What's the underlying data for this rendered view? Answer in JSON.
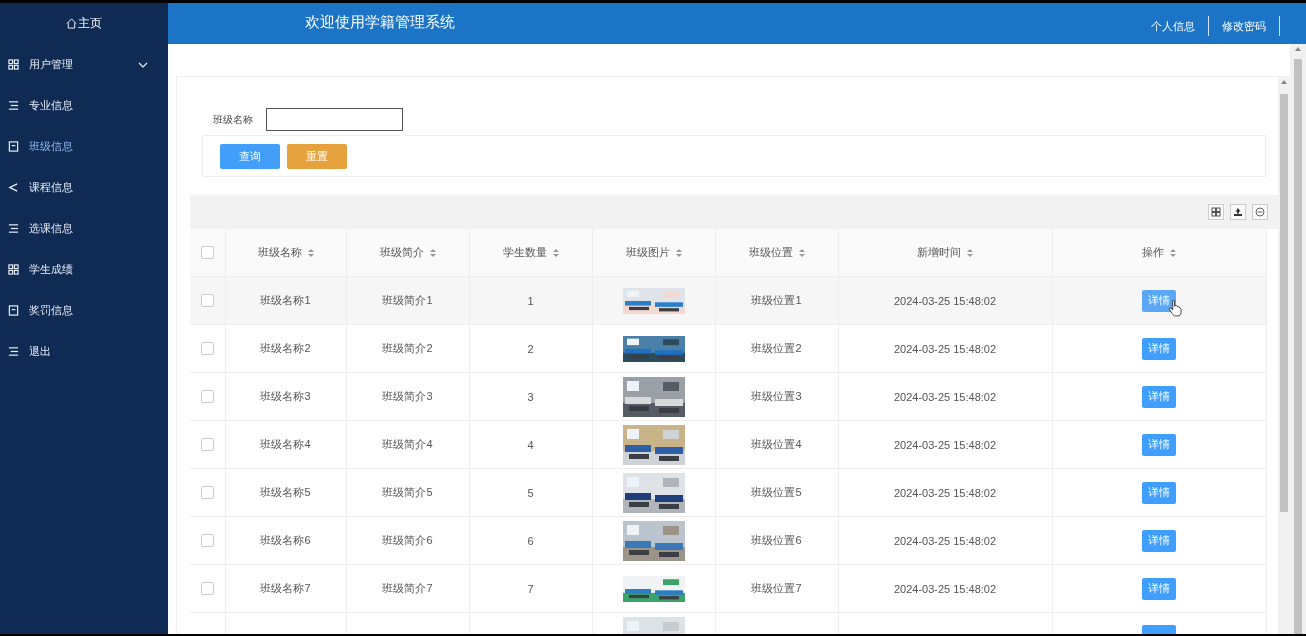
{
  "sidebar": {
    "home": "主页",
    "items": [
      {
        "label": "用户管理",
        "kind": "grid",
        "selected": false,
        "expandable": true
      },
      {
        "label": "专业信息",
        "kind": "list",
        "selected": false
      },
      {
        "label": "班级信息",
        "kind": "book",
        "selected": true
      },
      {
        "label": "课程信息",
        "kind": "share",
        "selected": false
      },
      {
        "label": "选课信息",
        "kind": "list",
        "selected": false
      },
      {
        "label": "学生成绩",
        "kind": "grid",
        "selected": false
      },
      {
        "label": "奖罚信息",
        "kind": "book",
        "selected": false
      },
      {
        "label": "退出",
        "kind": "list",
        "selected": false
      }
    ]
  },
  "header": {
    "title": "欢迎使用学籍管理系统",
    "links": [
      "个人信息",
      "修改密码"
    ]
  },
  "search": {
    "label": "班级名称",
    "buttons": [
      {
        "label": "查询",
        "kind": "primary"
      },
      {
        "label": "重置",
        "kind": "warning"
      }
    ]
  },
  "table": {
    "all_checked": false,
    "columns": [
      "班级名称",
      "班级简介",
      "学生数量",
      "班级图片",
      "班级位置",
      "新增时间",
      "操作"
    ],
    "rows": [
      {
        "kind": "full",
        "hovered": true,
        "checked": false,
        "name": "班级名称1",
        "intro": "班级简介1",
        "count": "1",
        "location": "班级位置1",
        "time": "2024-03-25 15:48:02",
        "action": "详情"
      },
      {
        "kind": "full",
        "hovered": false,
        "checked": false,
        "name": "班级名称2",
        "intro": "班级简介2",
        "count": "2",
        "location": "班级位置2",
        "time": "2024-03-25 15:48:02",
        "action": "详情"
      },
      {
        "kind": "full",
        "hovered": false,
        "checked": false,
        "name": "班级名称3",
        "intro": "班级简介3",
        "count": "3",
        "location": "班级位置3",
        "time": "2024-03-25 15:48:02",
        "action": "详情"
      },
      {
        "kind": "full",
        "hovered": false,
        "checked": false,
        "name": "班级名称4",
        "intro": "班级简介4",
        "count": "4",
        "location": "班级位置4",
        "time": "2024-03-25 15:48:02",
        "action": "详情"
      },
      {
        "kind": "full",
        "hovered": false,
        "checked": false,
        "name": "班级名称5",
        "intro": "班级简介5",
        "count": "5",
        "location": "班级位置5",
        "time": "2024-03-25 15:48:02",
        "action": "详情"
      },
      {
        "kind": "full",
        "hovered": false,
        "checked": false,
        "name": "班级名称6",
        "intro": "班级简介6",
        "count": "6",
        "location": "班级位置6",
        "time": "2024-03-25 15:48:02",
        "action": "详情"
      },
      {
        "kind": "full",
        "hovered": false,
        "checked": false,
        "name": "班级名称7",
        "intro": "班级简介7",
        "count": "7",
        "location": "班级位置7",
        "time": "2024-03-25 15:48:02",
        "action": "详情"
      },
      {
        "kind": "cut"
      }
    ]
  }
}
